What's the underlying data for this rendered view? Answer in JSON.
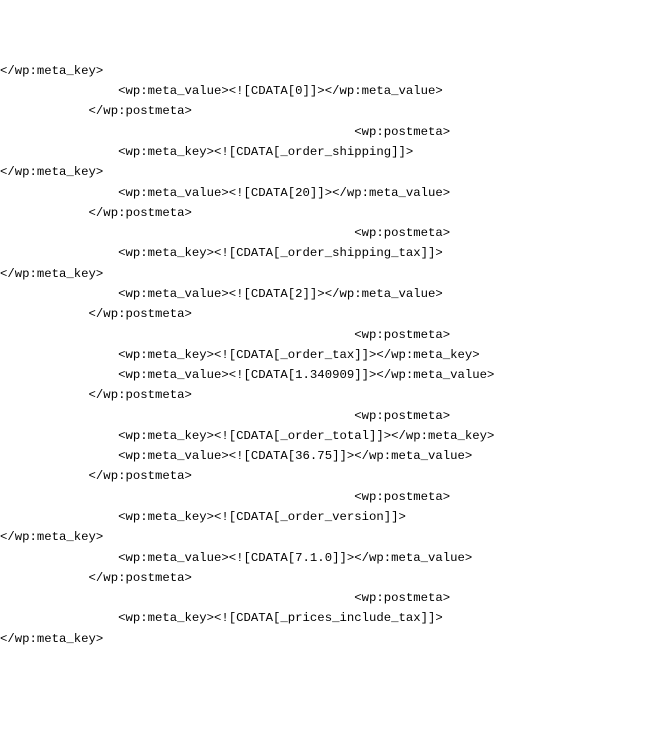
{
  "lines": [
    "</wp:meta_key>",
    "                <wp:meta_value><![CDATA[0]]></wp:meta_value>",
    "            </wp:postmeta>",
    "                                                <wp:postmeta>",
    "                <wp:meta_key><![CDATA[_order_shipping]]>",
    "</wp:meta_key>",
    "                <wp:meta_value><![CDATA[20]]></wp:meta_value>",
    "            </wp:postmeta>",
    "                                                <wp:postmeta>",
    "                <wp:meta_key><![CDATA[_order_shipping_tax]]>",
    "</wp:meta_key>",
    "                <wp:meta_value><![CDATA[2]]></wp:meta_value>",
    "            </wp:postmeta>",
    "                                                <wp:postmeta>",
    "                <wp:meta_key><![CDATA[_order_tax]]></wp:meta_key>",
    "                <wp:meta_value><![CDATA[1.340909]]></wp:meta_value>",
    "            </wp:postmeta>",
    "                                                <wp:postmeta>",
    "                <wp:meta_key><![CDATA[_order_total]]></wp:meta_key>",
    "                <wp:meta_value><![CDATA[36.75]]></wp:meta_value>",
    "            </wp:postmeta>",
    "                                                <wp:postmeta>",
    "                <wp:meta_key><![CDATA[_order_version]]>",
    "</wp:meta_key>",
    "                <wp:meta_value><![CDATA[7.1.0]]></wp:meta_value>",
    "            </wp:postmeta>",
    "                                                <wp:postmeta>",
    "                <wp:meta_key><![CDATA[_prices_include_tax]]>",
    "</wp:meta_key>"
  ]
}
